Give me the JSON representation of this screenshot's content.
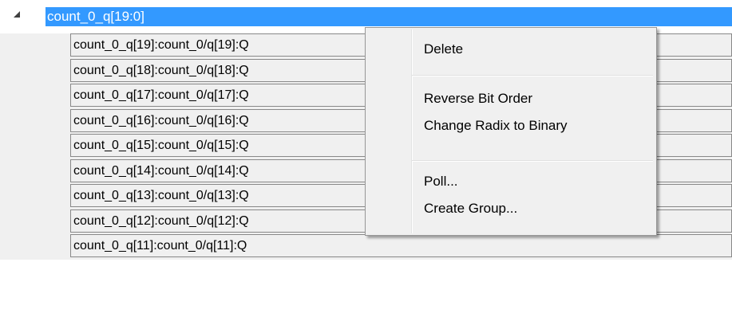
{
  "group": {
    "label": "count_0_q[19:0]",
    "expander_icon": "collapse-triangle-icon"
  },
  "signals": [
    "count_0_q[19]:count_0/q[19]:Q",
    "count_0_q[18]:count_0/q[18]:Q",
    "count_0_q[17]:count_0/q[17]:Q",
    "count_0_q[16]:count_0/q[16]:Q",
    "count_0_q[15]:count_0/q[15]:Q",
    "count_0_q[14]:count_0/q[14]:Q",
    "count_0_q[13]:count_0/q[13]:Q",
    "count_0_q[12]:count_0/q[12]:Q",
    "count_0_q[11]:count_0/q[11]:Q"
  ],
  "context_menu": {
    "delete": "Delete",
    "reverse_bit_order": "Reverse Bit Order",
    "change_radix": "Change Radix to Binary",
    "poll": "Poll...",
    "create_group": "Create Group..."
  },
  "colors": {
    "selection": "#3399ff",
    "row_background": "#f0f0f0",
    "row_border": "#888888",
    "menu_background": "#f0f0f0"
  }
}
